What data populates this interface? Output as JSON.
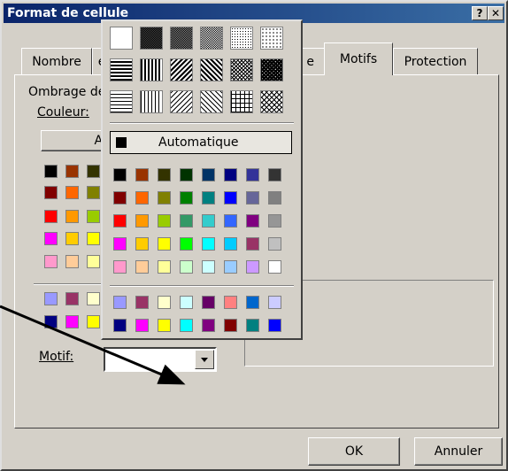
{
  "window": {
    "title": "Format de cellule",
    "help_btn": "?",
    "close_btn": "✕"
  },
  "tabs": [
    {
      "label": "Nombre"
    },
    {
      "label": "e"
    },
    {
      "label": "Motifs",
      "active": true
    },
    {
      "label": "Protection"
    }
  ],
  "panel": {
    "shading_label": "Ombrage de",
    "color_label": "Couleur:",
    "auto_button_label": "Au",
    "pattern_label": "Motif:",
    "pattern_value": ""
  },
  "popup": {
    "auto_label": "Automatique",
    "patterns": [
      "solid-white",
      "dense-dot-90",
      "dense-dot-75",
      "dot-50",
      "dot-25",
      "dot-12",
      "horizontal-stripe",
      "vertical-stripe",
      "reverse-diagonal",
      "diagonal-stripe",
      "diagonal-crosshatch",
      "thick-diagonal-crosshatch",
      "thin-horizontal",
      "thin-vertical",
      "thin-reverse-diagonal",
      "thin-diagonal",
      "thin-grid",
      "thin-diagonal-grid"
    ],
    "palette": [
      [
        "#000000",
        "#993300",
        "#333300",
        "#003300",
        "#003366",
        "#000080",
        "#333399",
        "#333333"
      ],
      [
        "#800000",
        "#FF6600",
        "#808000",
        "#008000",
        "#008080",
        "#0000FF",
        "#666699",
        "#808080"
      ],
      [
        "#FF0000",
        "#FF9900",
        "#99CC00",
        "#339966",
        "#33CCCC",
        "#3366FF",
        "#800080",
        "#969696"
      ],
      [
        "#FF00FF",
        "#FFCC00",
        "#FFFF00",
        "#00FF00",
        "#00FFFF",
        "#00CCFF",
        "#993366",
        "#C0C0C0"
      ],
      [
        "#FF99CC",
        "#FFCC99",
        "#FFFF99",
        "#CCFFCC",
        "#CCFFFF",
        "#99CCFF",
        "#CC99FF",
        "#FFFFFF"
      ]
    ],
    "chart_colors": [
      [
        "#9999FF",
        "#993366",
        "#FFFFCC",
        "#CCFFFF",
        "#660066",
        "#FF8080",
        "#0066CC",
        "#CCCCFF"
      ],
      [
        "#000080",
        "#FF00FF",
        "#FFFF00",
        "#00FFFF",
        "#800080",
        "#800000",
        "#008080",
        "#0000FF"
      ]
    ]
  },
  "buttons": {
    "ok": "OK",
    "cancel": "Annuler"
  }
}
